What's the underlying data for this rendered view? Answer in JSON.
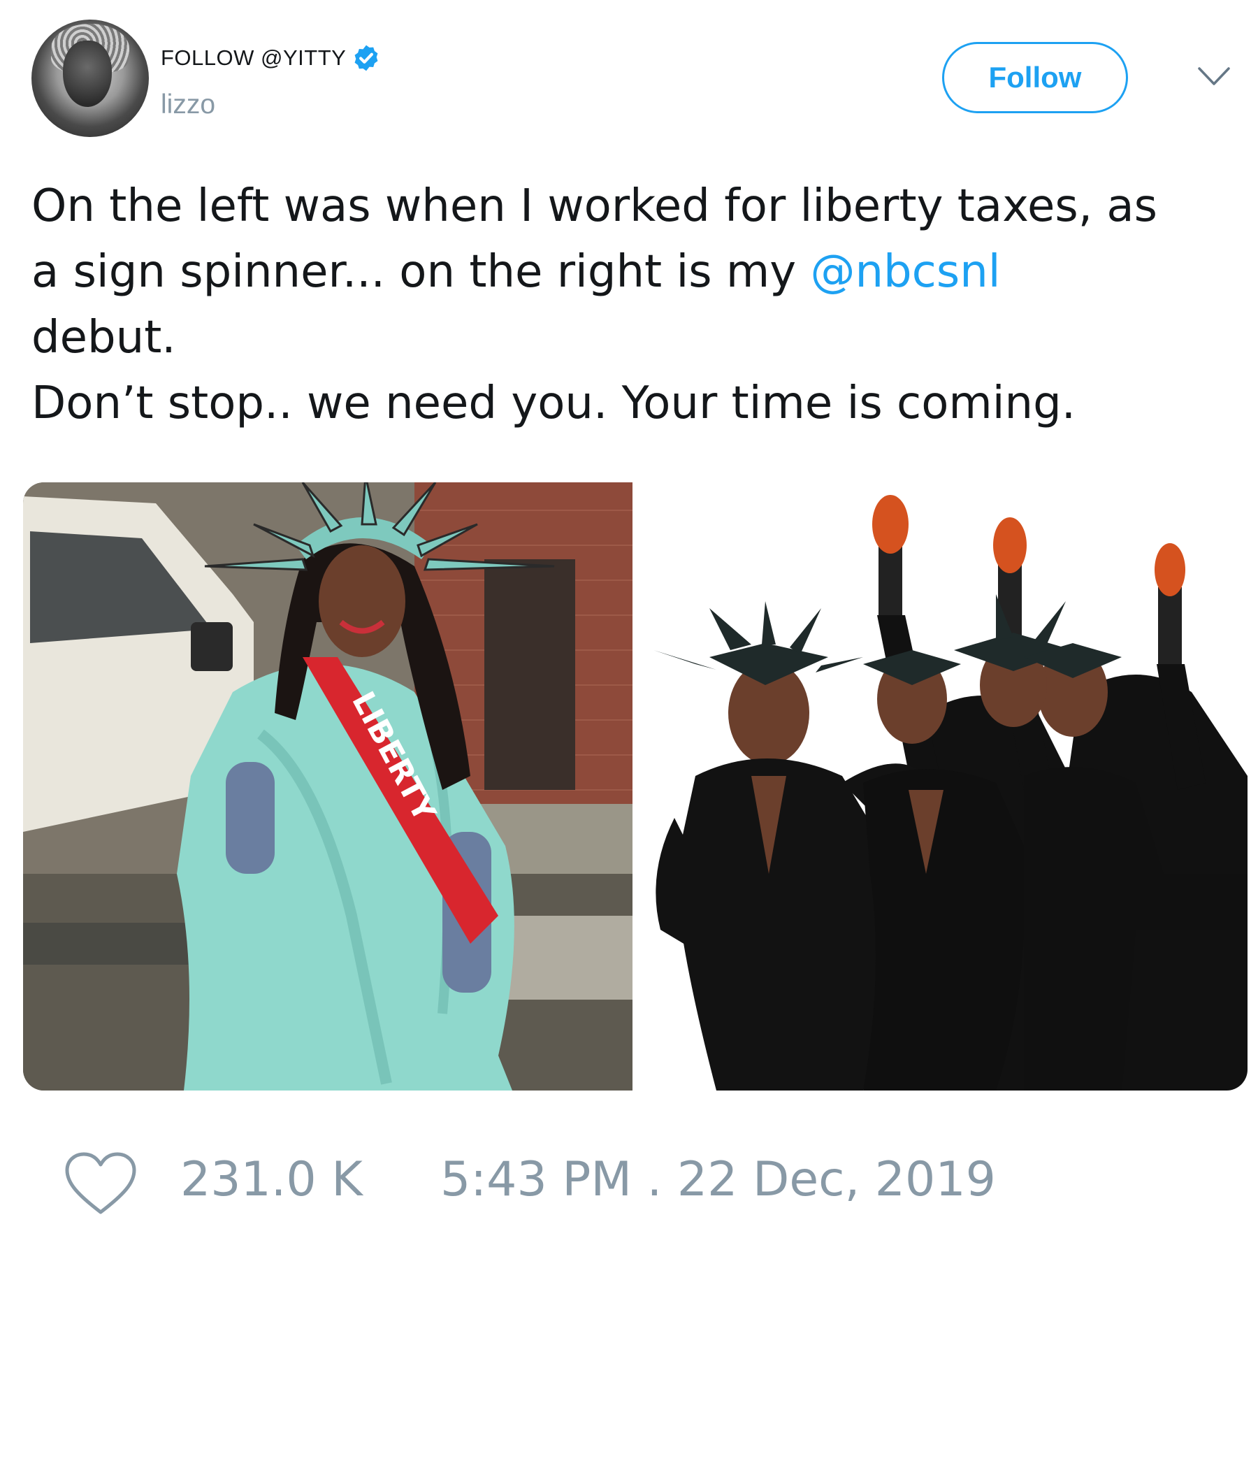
{
  "author": {
    "follow_handle": "FOLLOW @YITTY",
    "display_name": "lizzo",
    "verified": true
  },
  "actions": {
    "follow_label": "Follow",
    "menu_icon": "chevron-down-icon"
  },
  "tweet": {
    "line1": "On the left was when I worked for liberty taxes, as",
    "line2_pre": "a sign spinner... on the right is my ",
    "line2_mention": "@nbcsnl",
    "line3": "debut.",
    "line4": "Don’t stop.. we need you. Your time is coming."
  },
  "media": {
    "left_sash_text": "LIBERTY"
  },
  "footer": {
    "likes": "231.0 K",
    "timestamp": "5:43 PM . 22 Dec, 2019"
  },
  "colors": {
    "accent": "#1da1f2",
    "text": "#14171a",
    "muted": "#8899a6"
  }
}
